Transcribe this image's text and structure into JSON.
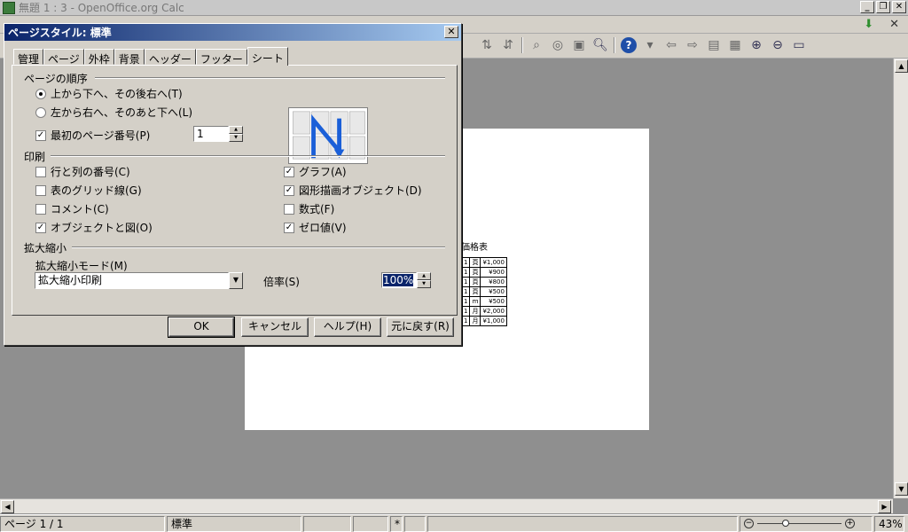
{
  "window": {
    "title": "無題 1 : 3 - OpenOffice.org Calc"
  },
  "statusbar": {
    "page": "ページ 1 / 1",
    "style": "標準",
    "star": "*",
    "zoom": "43%"
  },
  "sheet": {
    "title": "価格表",
    "rows": [
      [
        "1",
        "頁",
        "¥1,000"
      ],
      [
        "1",
        "頁",
        "¥900"
      ],
      [
        "1",
        "頁",
        "¥800"
      ],
      [
        "1",
        "頁",
        "¥500"
      ],
      [
        "1",
        "ｍ",
        "¥500"
      ],
      [
        "1",
        "月",
        "¥2,000"
      ],
      [
        "1",
        "月",
        "¥1,000"
      ]
    ]
  },
  "dialog": {
    "title": "ページスタイル: 標準",
    "tabs": [
      "管理",
      "ページ",
      "外枠",
      "背景",
      "ヘッダー",
      "フッター",
      "シート"
    ],
    "active_tab": "シート",
    "page_order": {
      "label": "ページの順序",
      "option1": "上から下へ、その後右へ(T)",
      "option2": "左から右へ、そのあと下へ(L)",
      "first_page_label": "最初のページ番号(P)",
      "first_page_value": "1"
    },
    "print": {
      "label": "印刷",
      "left": [
        {
          "label": "行と列の番号(C)",
          "checked": false
        },
        {
          "label": "表のグリッド線(G)",
          "checked": false
        },
        {
          "label": "コメント(C)",
          "checked": false
        },
        {
          "label": "オブジェクトと図(O)",
          "checked": true
        }
      ],
      "right": [
        {
          "label": "グラフ(A)",
          "checked": true
        },
        {
          "label": "図形描画オブジェクト(D)",
          "checked": true
        },
        {
          "label": "数式(F)",
          "checked": false
        },
        {
          "label": "ゼロ値(V)",
          "checked": true
        }
      ]
    },
    "scale": {
      "label": "拡大縮小",
      "mode_label": "拡大縮小モード(M)",
      "mode_value": "拡大縮小印刷",
      "factor_label": "倍率(S)",
      "factor_value": "100%"
    },
    "buttons": {
      "ok": "OK",
      "cancel": "キャンセル",
      "help": "ヘルプ(H)",
      "reset": "元に戻す(R)"
    }
  }
}
